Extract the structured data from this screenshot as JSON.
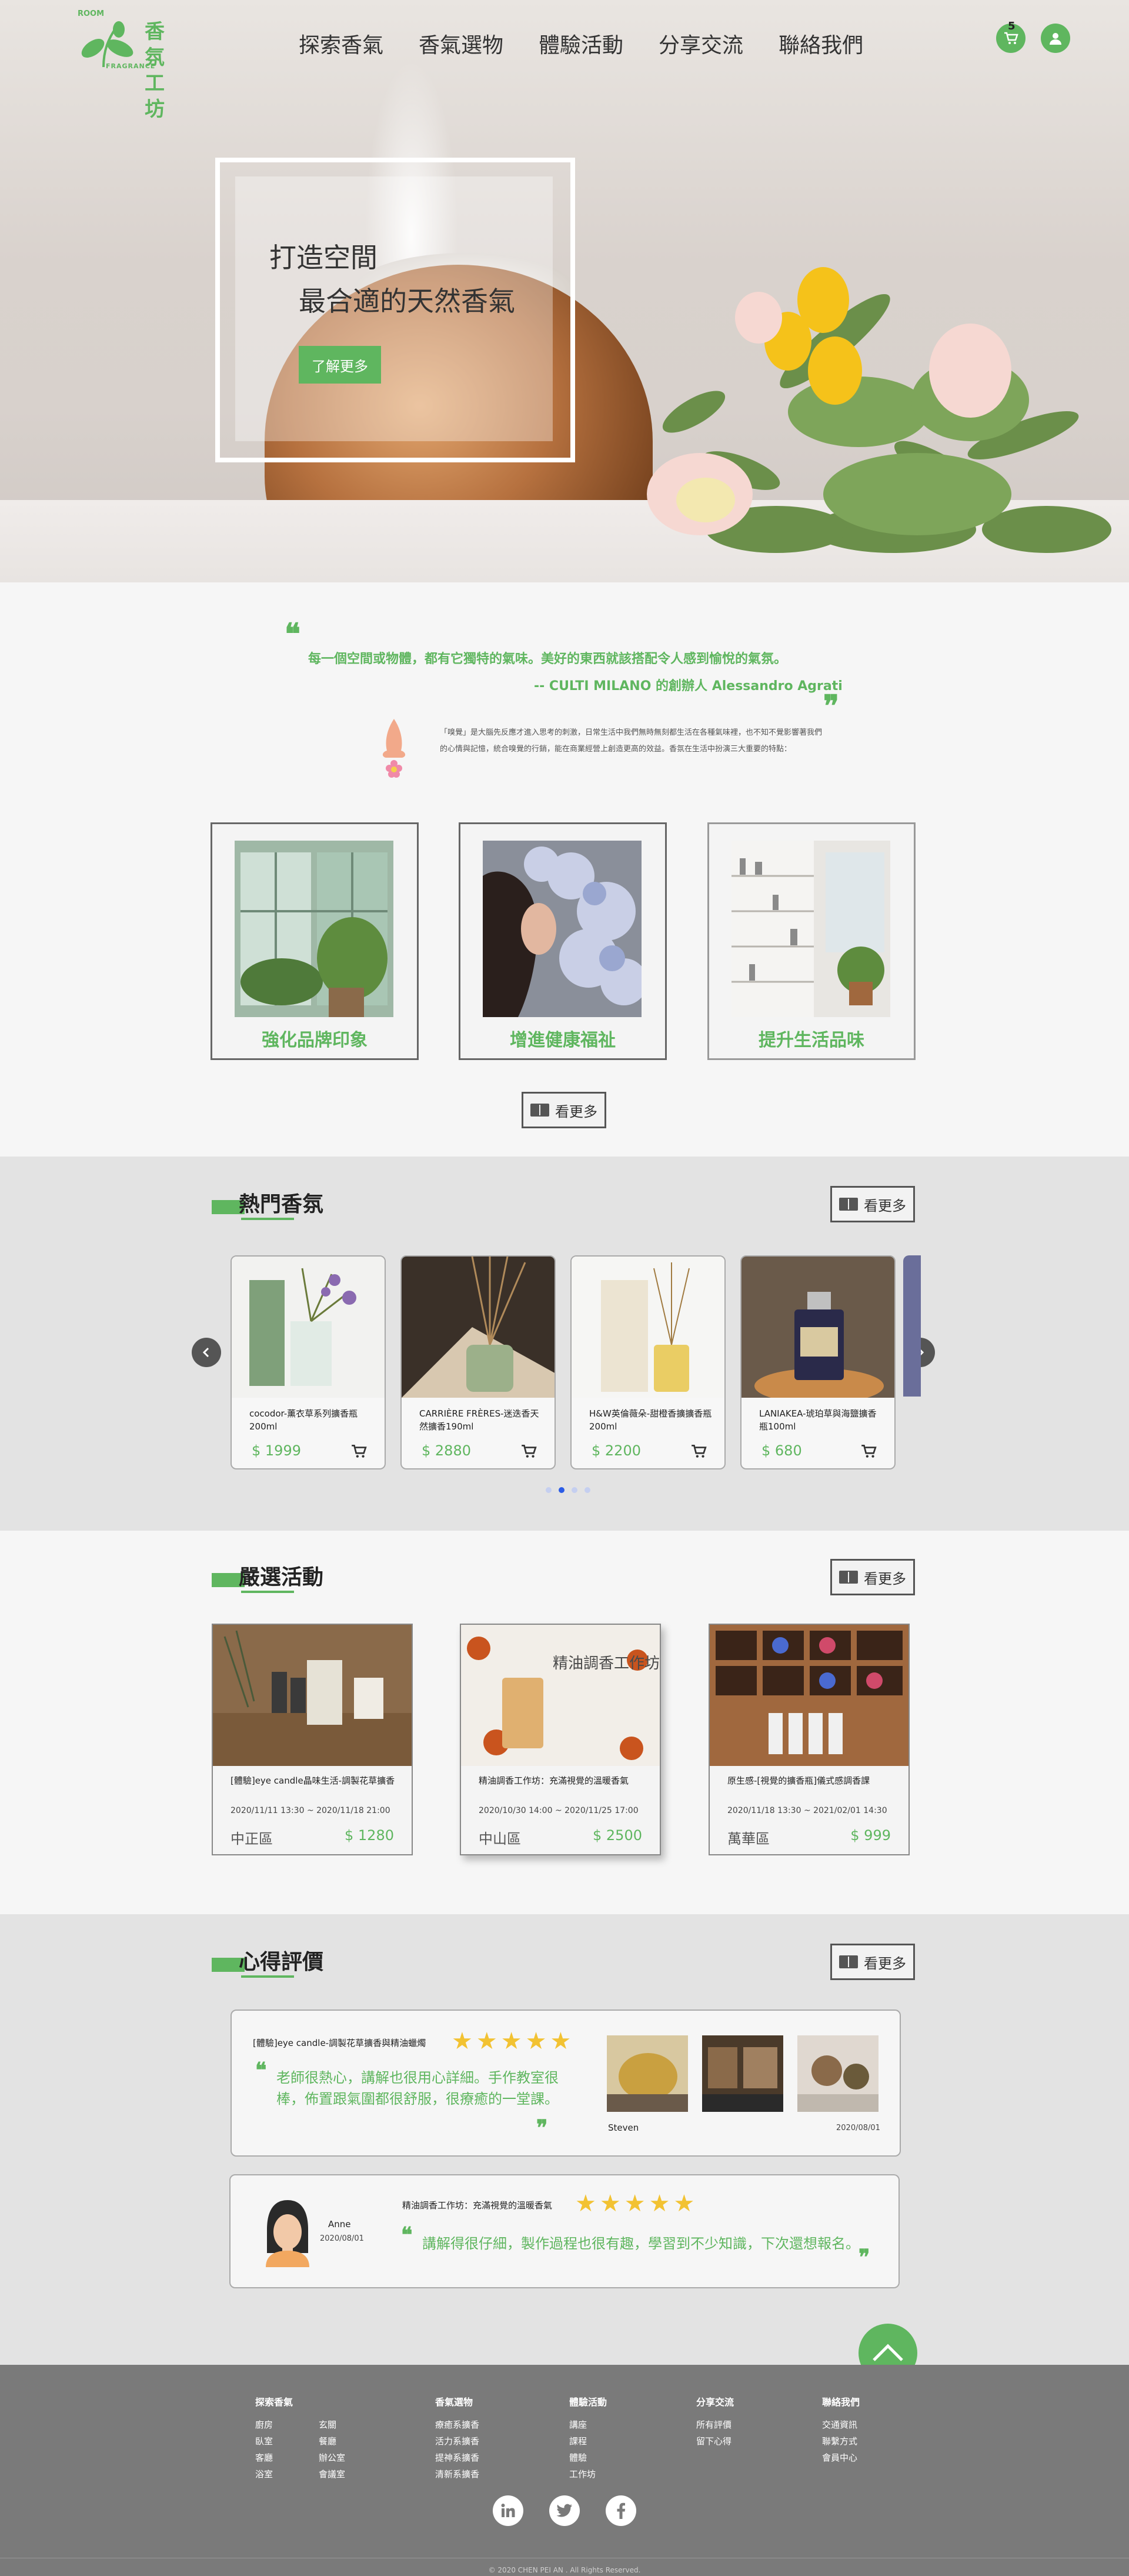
{
  "header": {
    "logo": {
      "tag": "ROOM",
      "name": "香氛工坊",
      "sub": "FRAGRANCE"
    },
    "nav": [
      "探索香氣",
      "香氣選物",
      "體驗活動",
      "分享交流",
      "聯絡我們"
    ],
    "cart_count": "5"
  },
  "hero": {
    "line1": "打造空間",
    "line2": "最合適的天然香氣",
    "cta": "了解更多"
  },
  "quote": {
    "line1": "每一個空間或物體，都有它獨特的氣味。美好的東西就該搭配令人感到愉悅的氣氛。",
    "line2": "-- CULTI MILANO 的創辦人 Alessandro Agrati",
    "desc": "「嗅覺」是大腦先反應才進入思考的刺激，日常生活中我們無時無刻都生活在各種氣味裡，也不知不覺影響著我們的心情與記憶，統合嗅覺的行銷，能在商業經營上創造更高的效益。香氛在生活中扮演三大重要的特點："
  },
  "features": [
    {
      "caption": "強化品牌印象"
    },
    {
      "caption": "增進健康福祉"
    },
    {
      "caption": "提升生活品味"
    }
  ],
  "more_label": "看更多",
  "hot": {
    "title": "熱門香氛",
    "products": [
      {
        "name": "cocodor-薰衣草系列擴香瓶200ml",
        "price": "$ 1999"
      },
      {
        "name": "CARRIÈRE FRÈRES-迷迭香天然擴香190ml",
        "price": "$ 2880"
      },
      {
        "name": "H&W英倫薇朵-甜橙香擴擴香瓶200ml",
        "price": "$ 2200"
      },
      {
        "name": "LANIAKEA-琥珀草與海鹽擴香瓶100ml",
        "price": "$ 680"
      }
    ]
  },
  "events": {
    "title": "嚴選活動",
    "items": [
      {
        "name": "[體驗]eye candle晶味生活-調製花草擴香",
        "date": "2020/11/11 13:30 ~ 2020/11/18 21:00",
        "area": "中正區",
        "price": "$ 1280"
      },
      {
        "name": "精油調香工作坊：充滿視覺的溫暖香氣",
        "date": "2020/10/30 14:00 ~ 2020/11/25 17:00",
        "area": "中山區",
        "price": "$ 2500"
      },
      {
        "name": "原生感-[視覺的擴香瓶]儀式感調香課",
        "date": "2020/11/18 13:30 ~ 2021/02/01 14:30",
        "area": "萬華區",
        "price": "$ 999"
      }
    ],
    "photo_text": {
      "title": "精油調香工作坊"
    }
  },
  "reviews": {
    "title": "心得評價",
    "items": [
      {
        "title": "[體驗]eye candle-調製花草擴香與精油蠟燭",
        "text": "老師很熱心，講解也很用心詳細。手作教室很棒，佈置跟氣圍都很舒服，很療癒的一堂課。",
        "name": "Steven",
        "date": "2020/08/01"
      },
      {
        "title": "精油調香工作坊：充滿視覺的溫暖香氣",
        "text": "講解得很仔細，製作過程也很有趣，學習到不少知識，下次還想報名。",
        "name": "Anne",
        "date": "2020/08/01"
      }
    ]
  },
  "footer": {
    "cols": [
      {
        "head": "探索香氣",
        "items": [
          "廚房",
          "玄關",
          "臥室",
          "餐廳",
          "客廳",
          "辦公室",
          "浴室",
          "會議室"
        ]
      },
      {
        "head": "香氣選物",
        "items": [
          "療癒系擴香",
          "活力系擴香",
          "提神系擴香",
          "清新系擴香"
        ]
      },
      {
        "head": "體驗活動",
        "items": [
          "講座",
          "課程",
          "體驗",
          "工作坊"
        ]
      },
      {
        "head": "分享交流",
        "items": [
          "所有評價",
          "留下心得"
        ]
      },
      {
        "head": "聯絡我們",
        "items": [
          "交通資訊",
          "聯繫方式",
          "會員中心"
        ]
      }
    ],
    "copyright": "© 2020 CHEN PEI AN . All Rights Reserved."
  },
  "colors": {
    "accent": "#5fb65f",
    "star": "#f2c232",
    "footer": "#7a7a7a"
  }
}
